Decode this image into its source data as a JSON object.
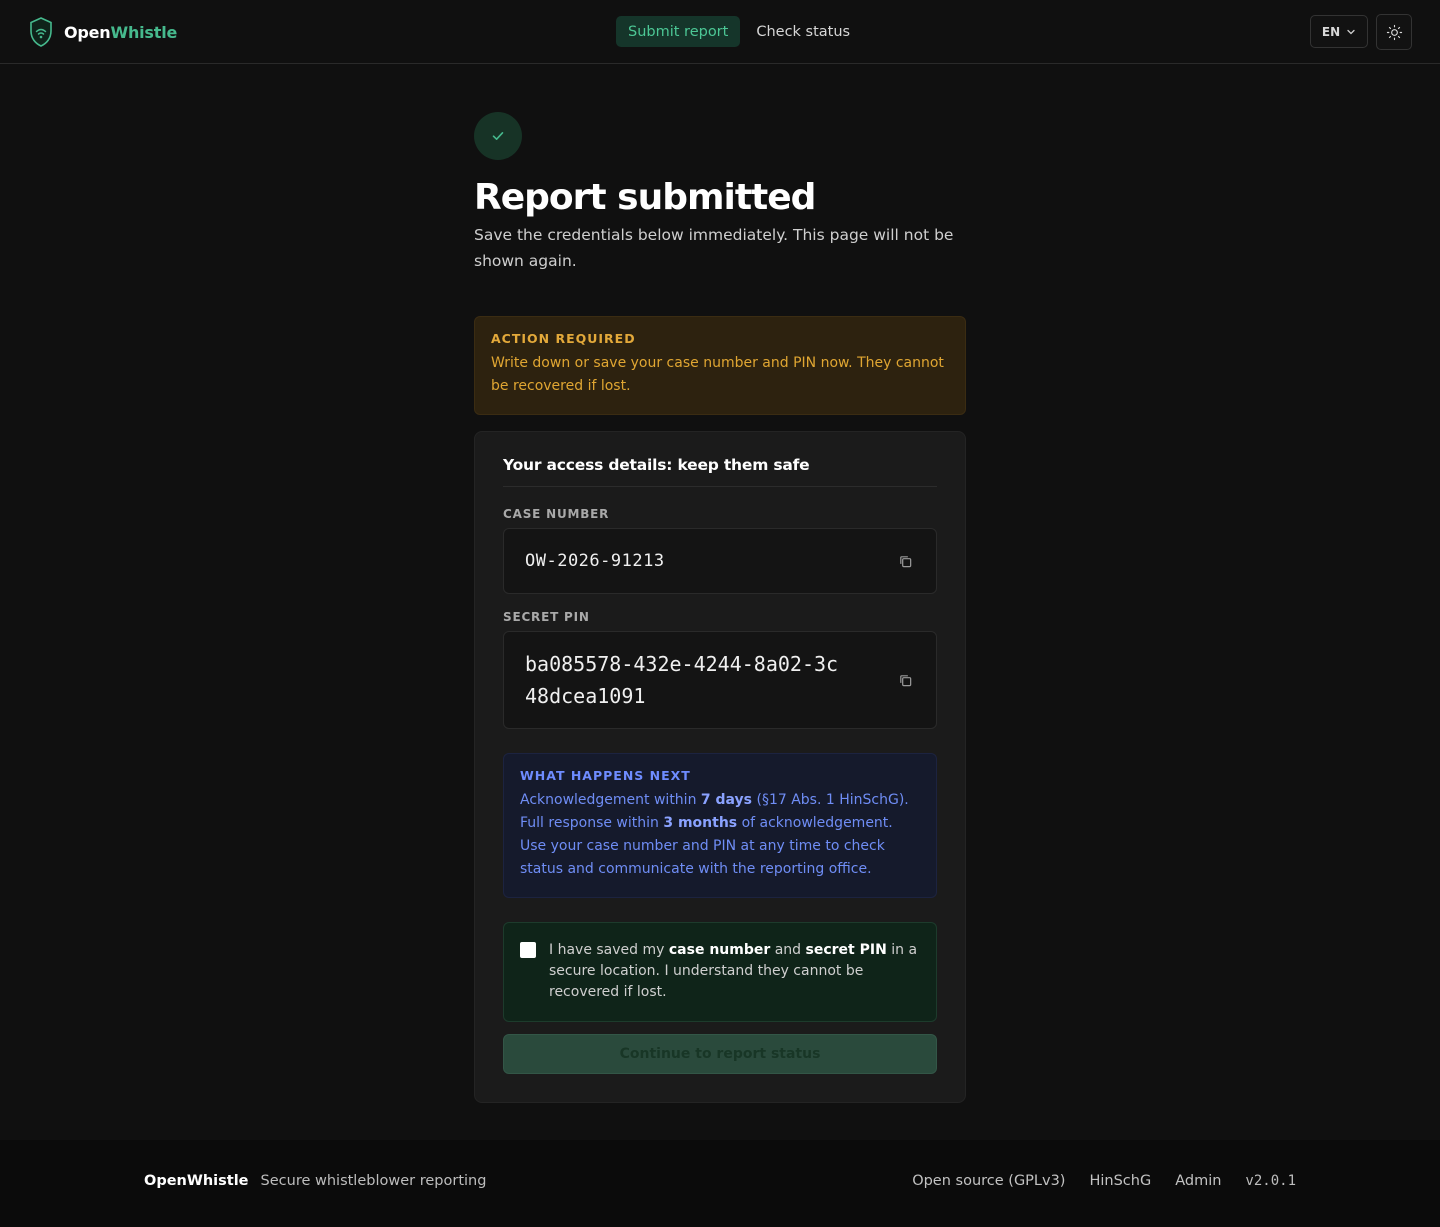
{
  "header": {
    "brand_open": "Open",
    "brand_whistle": "Whistle",
    "nav": [
      {
        "label": "Submit report",
        "active": true
      },
      {
        "label": "Check status",
        "active": false
      }
    ],
    "language": "EN",
    "theme_icon": "sun-icon"
  },
  "main": {
    "title": "Report submitted",
    "subtitle": "Save the credentials below immediately. This page will not be shown again.",
    "warning": {
      "title": "ACTION REQUIRED",
      "text": "Write down or save your case number and PIN now. They cannot be recovered if lost."
    },
    "card": {
      "title": "Your access details: keep them safe",
      "case_label": "CASE NUMBER",
      "case_value": "OW-2026-91213",
      "pin_label": "SECRET PIN",
      "pin_value": "ba085578-432e-4244-8a02-3c48dcea1091",
      "info": {
        "title": "WHAT HAPPENS NEXT",
        "t1": "Acknowledgement within ",
        "b1": "7 days",
        "t2": " (§17 Abs. 1 HinSchG). Full response within ",
        "b2": "3 months",
        "t3": " of acknowledgement. Use your case number and PIN at any time to check status and communicate with the reporting office."
      },
      "confirm": {
        "checked": false,
        "t1": "I have saved my ",
        "b1": "case number",
        "t2": " and ",
        "b2": "secret PIN",
        "t3": " in a secure location. I understand they cannot be recovered if lost."
      },
      "continue_label": "Continue to report status"
    }
  },
  "footer": {
    "brand": "OpenWhistle",
    "tagline": "Secure whistleblower reporting",
    "links": [
      "Open source (GPLv3)",
      "HinSchG",
      "Admin"
    ],
    "version": "v2.0.1"
  },
  "colors": {
    "accent": "#46b98d",
    "warning": "#e0a632",
    "info": "#6f8df5",
    "background": "#101010"
  }
}
